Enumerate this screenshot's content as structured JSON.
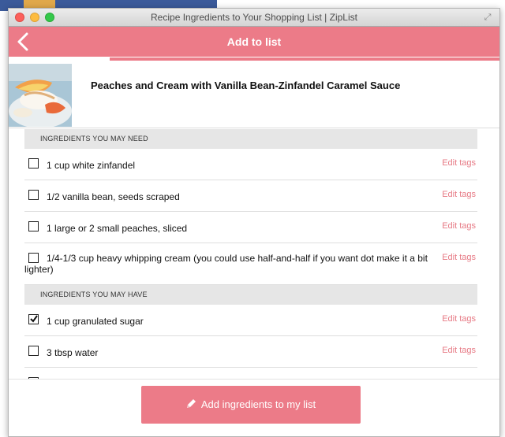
{
  "window": {
    "title": "Recipe Ingredients to Your Shopping List | ZipList"
  },
  "app": {
    "title": "Add to list"
  },
  "recipe": {
    "title": "Peaches and Cream with Vanilla Bean-Zinfandel Caramel Sauce"
  },
  "sections": [
    {
      "header": "INGREDIENTS YOU MAY NEED",
      "items": [
        {
          "text": "1 cup white zinfandel",
          "checked": false,
          "action": "Edit tags"
        },
        {
          "text": "1/2 vanilla bean, seeds scraped",
          "checked": false,
          "action": "Edit tags"
        },
        {
          "text": "1 large or 2 small peaches, sliced",
          "checked": false,
          "action": "Edit tags"
        },
        {
          "text": "1/4-1/3 cup heavy whipping cream (you could use half-and-half if you want dot make it a bit lighter)",
          "checked": false,
          "action": "Edit tags"
        }
      ]
    },
    {
      "header": "INGREDIENTS YOU MAY HAVE",
      "items": [
        {
          "text": "1 cup granulated sugar",
          "checked": true,
          "action": "Edit tags"
        },
        {
          "text": "3 tbsp water",
          "checked": false,
          "action": "Edit tags"
        }
      ]
    }
  ],
  "footer": {
    "button_label": "Add ingredients to my list"
  },
  "colors": {
    "accent": "#ec7b88",
    "link": "#e77a85"
  }
}
